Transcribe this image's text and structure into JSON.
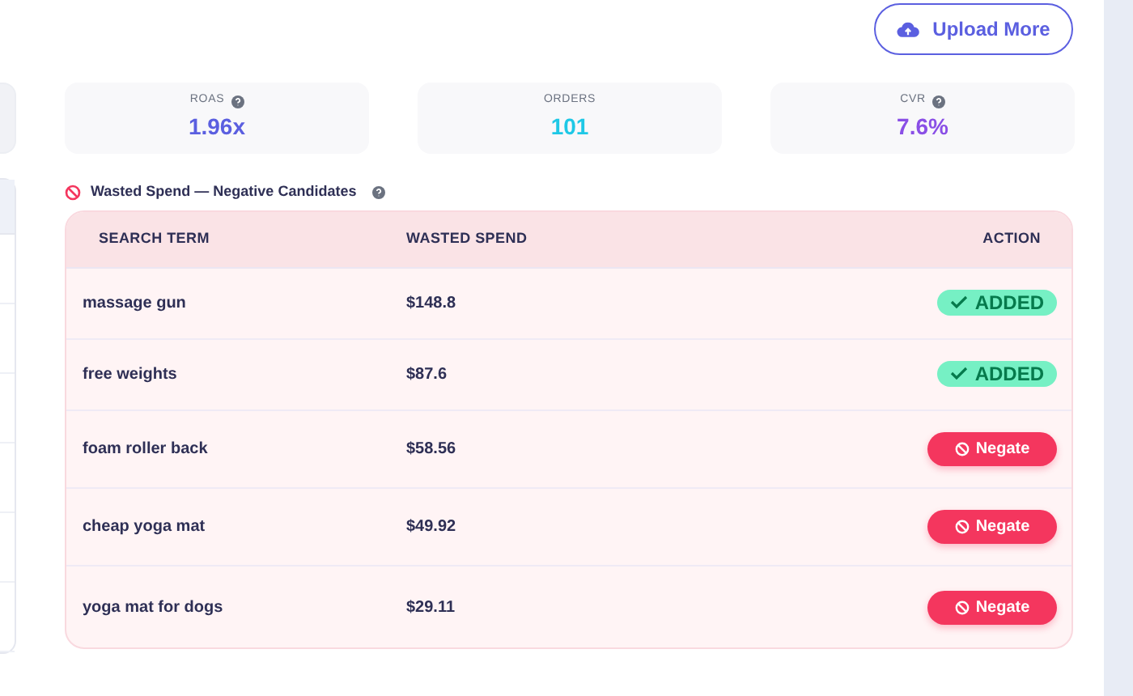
{
  "upload_button": {
    "label": "Upload More"
  },
  "stats": [
    {
      "label": "ROAS",
      "value": "1.96x",
      "help": true,
      "color": "#5b5fe0"
    },
    {
      "label": "ORDERS",
      "value": "101",
      "help": false,
      "color": "#1ec8e6"
    },
    {
      "label": "CVR",
      "value": "7.6%",
      "help": true,
      "color": "#8a4fe6"
    }
  ],
  "section": {
    "title": "Wasted Spend — Negative Candidates"
  },
  "table": {
    "columns": [
      "SEARCH TERM",
      "WASTED SPEND",
      "ACTION"
    ],
    "rows": [
      {
        "term": "massage gun",
        "spend": "$148.8",
        "action": {
          "kind": "added",
          "label": "ADDED"
        }
      },
      {
        "term": "free weights",
        "spend": "$87.6",
        "action": {
          "kind": "added",
          "label": "ADDED"
        }
      },
      {
        "term": "foam roller back",
        "spend": "$58.56",
        "action": {
          "kind": "negate",
          "label": "Negate"
        }
      },
      {
        "term": "cheap yoga mat",
        "spend": "$49.92",
        "action": {
          "kind": "negate",
          "label": "Negate"
        }
      },
      {
        "term": "yoga mat for dogs",
        "spend": "$29.11",
        "action": {
          "kind": "negate",
          "label": "Negate"
        }
      }
    ]
  }
}
